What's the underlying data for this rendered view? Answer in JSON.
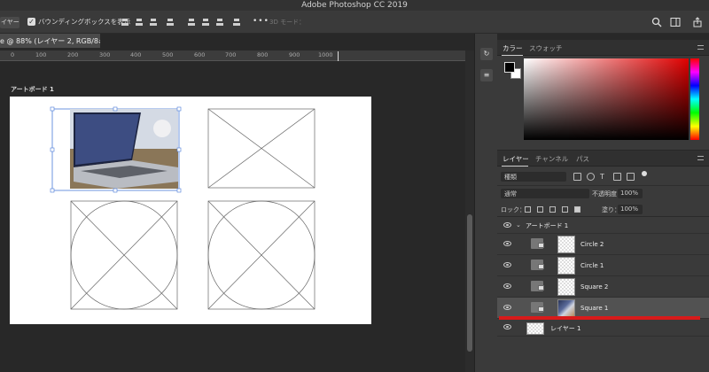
{
  "app": {
    "title": "Adobe Photoshop CC 2019"
  },
  "options": {
    "layer_select": "イヤー",
    "bbox_checked": "✓",
    "bbox_label": "バウンディングボックスを表示",
    "more": "•••",
    "mode3d": "3D モード："
  },
  "document": {
    "tab_label": "e @ 88% (レイヤー 2, RGB/8#) *",
    "ruler_numbers": [
      "0",
      "100",
      "200",
      "300",
      "400",
      "500",
      "600",
      "700",
      "800",
      "900",
      "1000"
    ],
    "artboard_label": "アートボード 1"
  },
  "color_panel": {
    "tabs": [
      "カラー",
      "スウォッチ"
    ],
    "colors": {
      "foreground": "#000000",
      "background": "#ffffff",
      "hue": "#e00000"
    }
  },
  "layers_panel": {
    "tabs": [
      "レイヤー",
      "チャンネル",
      "パス"
    ],
    "filter_kind": "種類",
    "blend_mode": "通常",
    "opacity_label": "不透明度：",
    "opacity_value": "100%",
    "lock_label": "ロック：",
    "fill_label": "塗り：",
    "fill_value": "100%",
    "group": {
      "name": "アートボード 1"
    },
    "layers": [
      {
        "name": "Circle 2"
      },
      {
        "name": "Circle 1"
      },
      {
        "name": "Square 2"
      },
      {
        "name": "Square 1"
      },
      {
        "name": "レイヤー 1"
      }
    ]
  }
}
